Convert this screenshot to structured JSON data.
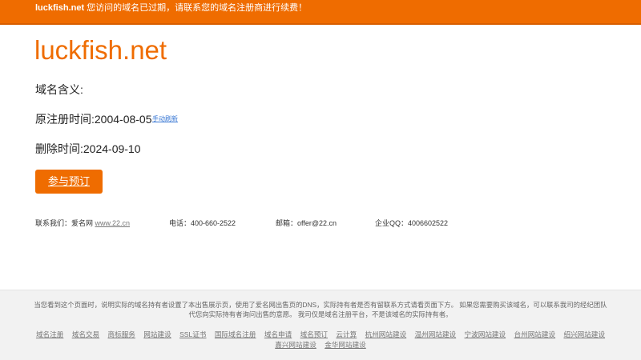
{
  "topbar": {
    "domain": "luckfish.net",
    "message": " 您访问的域名已过期，请联系您的域名注册商进行续费！"
  },
  "main": {
    "domain_title": "luckfish.net",
    "meaning_label": "域名含义:",
    "registered_label": "原注册时间:2004-08-05",
    "refresh_link": "手动刷新",
    "deleted_label": "删除时间:2024-09-10",
    "buy_button": "参与预订"
  },
  "contact": {
    "us_label": "联系我们：爱名网 ",
    "us_link": "www.22.cn",
    "phone": "电话：400-660-2522",
    "email": "邮箱：offer@22.cn",
    "qq": "企业QQ：4006602522"
  },
  "footer": {
    "notice": "当您看到这个页面时，说明实际的域名持有者设置了本出售展示页，使用了爱名网出售页的DNS，实际持有者是否有留联系方式请看页面下方。 如果您需要购买该域名，可以联系我司的经纪团队代您向实际持有者询问出售的意愿。 我司仅是域名注册平台，不是该域名的实际持有者。",
    "links": [
      "域名注册",
      "域名交易",
      "商标服务",
      "网站建设",
      "SSL证书",
      "国际域名注册",
      "域名申请",
      "域名预订",
      "云计算",
      "杭州网站建设",
      "温州网站建设",
      "宁波网站建设",
      "台州网站建设",
      "绍兴网站建设",
      "嘉兴网站建设",
      "金华网站建设"
    ]
  }
}
